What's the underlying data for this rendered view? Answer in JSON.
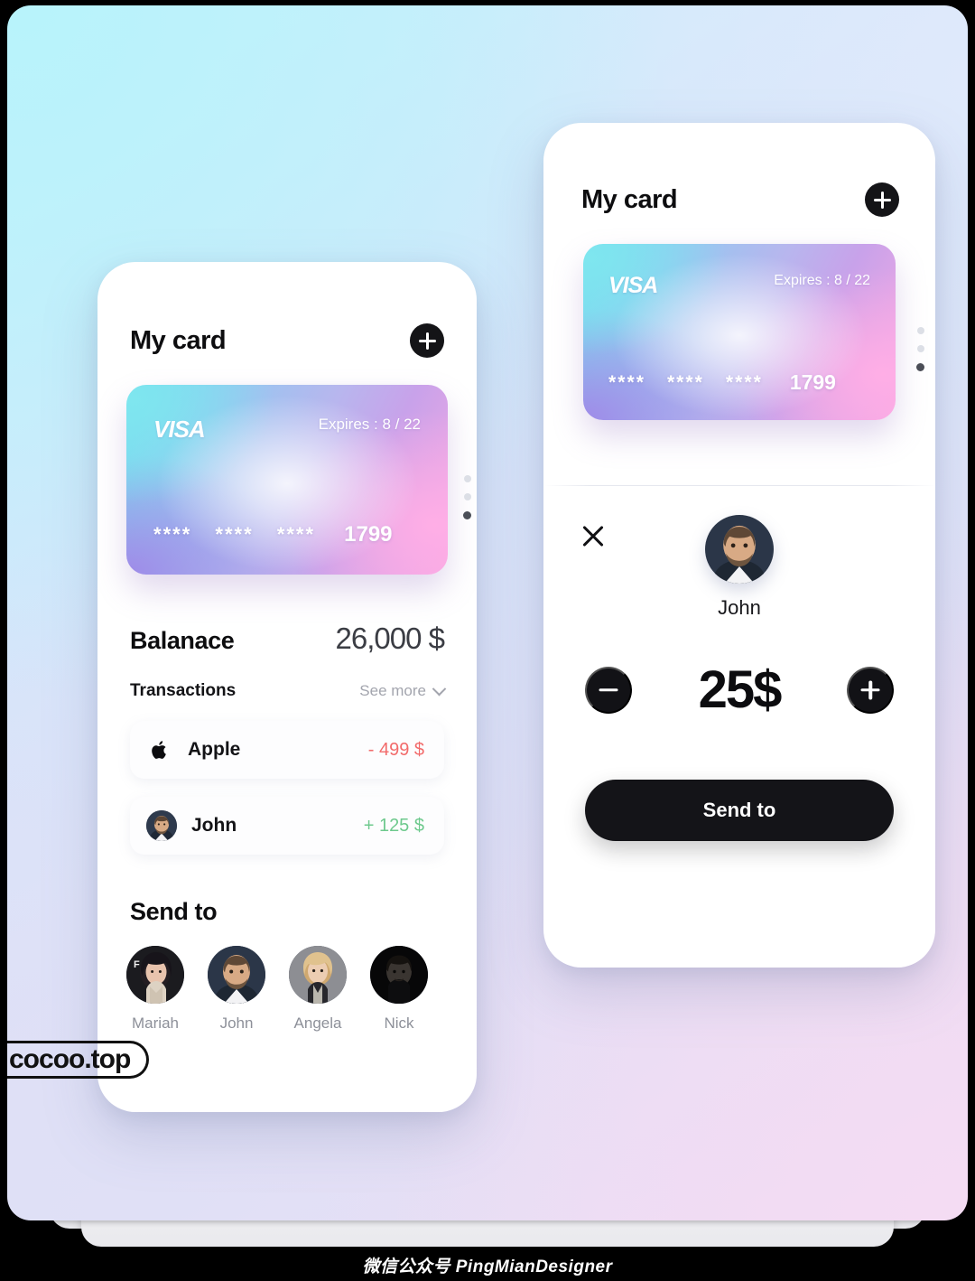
{
  "canvas": {
    "background_colors": [
      "#c5f2fb",
      "#d4e6fb",
      "#e0e0f7",
      "#f0dcf2"
    ]
  },
  "watermarks": {
    "logo_text": "cocoo.top",
    "footer_text": "微信公众号 PingMianDesigner"
  },
  "phone_left": {
    "header": {
      "title": "My card",
      "add_button_icon": "plus-icon"
    },
    "card": {
      "brand": "VISA",
      "expires_label": "Expires : 8 / 22",
      "number_groups": [
        "****",
        "****",
        "****"
      ],
      "last_four": "1799",
      "accent_colors": [
        "#71dfef",
        "#b8b6ee",
        "#f7a8e2"
      ]
    },
    "pager": {
      "dots": 3,
      "active_index": 2
    },
    "balance": {
      "label": "Balanace",
      "value": "26,000 $"
    },
    "transactions": {
      "title": "Transactions",
      "see_more_label": "See more",
      "see_more_icon": "chevron-down-icon",
      "items": [
        {
          "icon": "apple-logo-icon",
          "name": "Apple",
          "amount": "- 499 $",
          "type": "debit",
          "color": "#f26b6b"
        },
        {
          "icon": "avatar-john",
          "name": "John",
          "amount": "+ 125 $",
          "type": "credit",
          "color": "#6ec98d"
        }
      ]
    },
    "send_to": {
      "title": "Send to",
      "contacts": [
        {
          "name": "Mariah",
          "avatar": "avatar-mariah"
        },
        {
          "name": "John",
          "avatar": "avatar-john"
        },
        {
          "name": "Angela",
          "avatar": "avatar-angela"
        },
        {
          "name": "Nick",
          "avatar": "avatar-nick"
        }
      ]
    }
  },
  "phone_right": {
    "header": {
      "title": "My card",
      "add_button_icon": "plus-icon"
    },
    "card": {
      "brand": "VISA",
      "expires_label": "Expires : 8 / 22",
      "number_groups": [
        "****",
        "****",
        "****"
      ],
      "last_four": "1799"
    },
    "pager": {
      "dots": 3,
      "active_index": 2
    },
    "transfer": {
      "close_icon": "close-icon",
      "recipient_name": "John",
      "recipient_avatar": "avatar-john",
      "decrement_icon": "minus-icon",
      "increment_icon": "plus-icon",
      "amount": "25$",
      "submit_label": "Send to"
    }
  }
}
